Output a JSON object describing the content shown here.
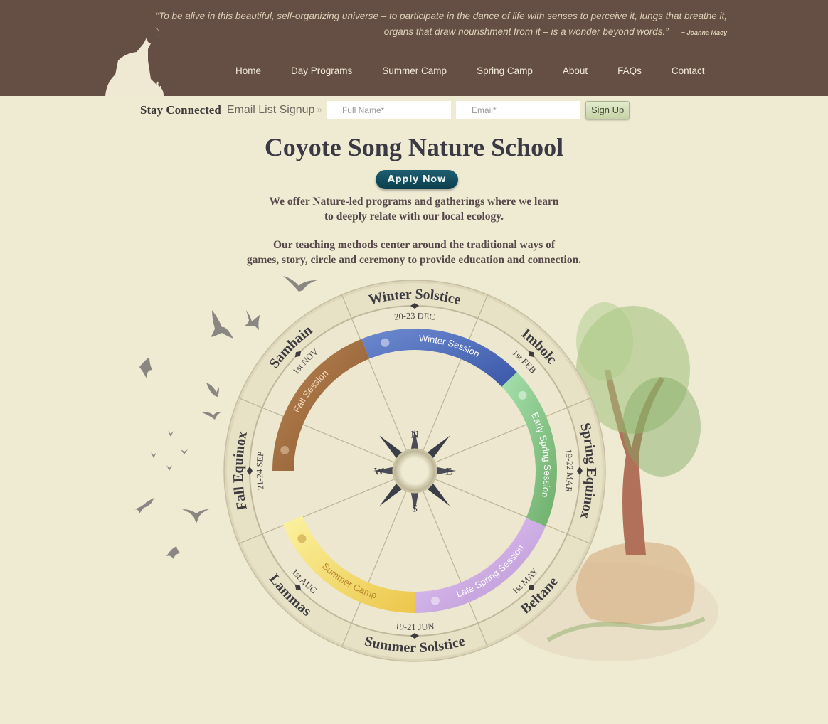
{
  "header": {
    "quote": "“To be alive in this beautiful, self-organizing universe – to participate in the dance of life with senses to perceive it, lungs that breathe it, organs that draw nourishment from it – is a wonder beyond words.”",
    "quote_author": "~ Joanna Macy",
    "nav": [
      "Home",
      "Day Programs",
      "Summer Camp",
      "Spring Camp",
      "About",
      "FAQs",
      "Contact"
    ]
  },
  "signup": {
    "title": "Stay Connected",
    "subtitle": "Email List Signup",
    "chevron": "»",
    "name_placeholder": "Full Name*",
    "email_placeholder": "Email*",
    "button": "Sign Up"
  },
  "main": {
    "title": "Coyote Song Nature School",
    "apply": "Apply Now",
    "intro1": [
      "We offer Nature-led programs and gatherings where we learn",
      "to deeply relate with our local ecology."
    ],
    "intro2": [
      "Our teaching methods center around the traditional ways of",
      "games, story, circle and ceremony to provide education and connection."
    ]
  },
  "wheel": {
    "stations": [
      {
        "label": "Winter Solstice",
        "date": "20-23 DEC"
      },
      {
        "label": "Imbolc",
        "date": "1st FEB"
      },
      {
        "label": "Spring Equinox",
        "date": "19-22 MAR"
      },
      {
        "label": "Beltane",
        "date": "1st MAY"
      },
      {
        "label": "Summer Solstice",
        "date": "19-21 JUN"
      },
      {
        "label": "Lammas",
        "date": "1st AUG"
      },
      {
        "label": "Fall Equinox",
        "date": "21-24 SEP"
      },
      {
        "label": "Samhain",
        "date": "1st NOV"
      }
    ],
    "sessions": [
      {
        "label": "Winter Session",
        "icon": "snowflake-icon",
        "color1": "#3a57a8",
        "color2": "#6d8ad0",
        "text": "#ffffff"
      },
      {
        "label": "Early Spring Session",
        "icon": "leaf-icon",
        "color1": "#6fae6a",
        "color2": "#a6e0ad",
        "text": "#ffffff"
      },
      {
        "label": "Late Spring Session",
        "icon": "flower-icon",
        "color1": "#b792d0",
        "color2": "#e6cbfa",
        "text": "#ffffff"
      },
      {
        "label": "Summer Camp",
        "icon": "sun-icon",
        "color1": "#ecc64a",
        "color2": "#fbf3a0",
        "text": "#b9892e"
      },
      {
        "label": "Fall Session",
        "icon": "maple-leaf-icon",
        "color1": "#8a5a30",
        "color2": "#b98352",
        "text": "#f3dcc0"
      }
    ],
    "compass": [
      "N",
      "E",
      "S",
      "W"
    ]
  }
}
